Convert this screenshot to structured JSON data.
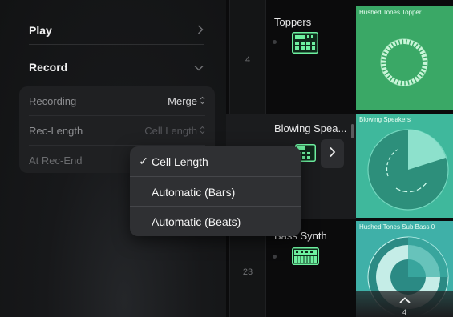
{
  "sidebar": {
    "play": {
      "label": "Play",
      "chevron": "chevron-right-icon",
      "expanded": false
    },
    "record": {
      "label": "Record",
      "chevron": "chevron-down-icon",
      "expanded": true
    },
    "settings": [
      {
        "label": "Recording",
        "value": "Merge",
        "control": "up-down-arrows-icon"
      },
      {
        "label": "Rec-Length",
        "value": "Cell Length",
        "control": "up-down-arrows-icon"
      },
      {
        "label": "At Rec-End",
        "value": ""
      }
    ]
  },
  "popup_menu": {
    "selected_index": 0,
    "options": [
      "Cell Length",
      "Automatic (Bars)",
      "Automatic (Beats)"
    ]
  },
  "grid": {
    "row_numbers": [
      "4",
      "23"
    ],
    "tracks": [
      {
        "name": "Toppers",
        "icon": "drum-machine-icon"
      },
      {
        "name": "Blowing Spea...",
        "icon": "drum-machine-icon"
      },
      {
        "name": "Bass Synth",
        "icon": "synth-keyboard-icon"
      }
    ],
    "clips": [
      {
        "title": "Hushed Tones Topper",
        "color": "#3aa866",
        "waveform": "circular"
      },
      {
        "title": "Blowing Speakers",
        "color": "#3fb89c",
        "waveform": "pie-progress"
      },
      {
        "title": "Hushed Tones Sub Bass 0",
        "color": "#3fb0a8",
        "waveform": "circular"
      }
    ],
    "footer": {
      "icon": "chevron-up-icon",
      "count": "4"
    }
  },
  "colors": {
    "accent_green": "#7af0a4",
    "clip_green": "#3aa866",
    "clip_teal": "#3fb89c"
  }
}
